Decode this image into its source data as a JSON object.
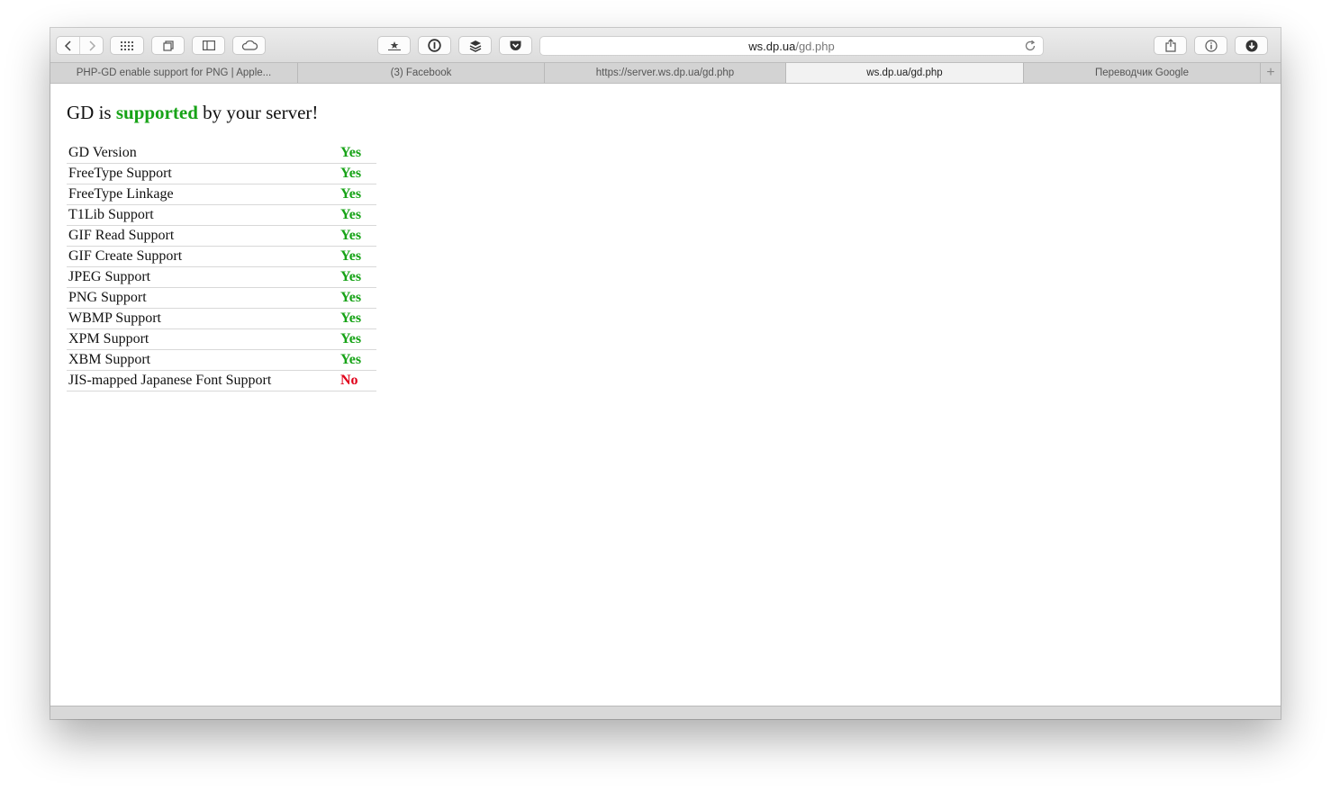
{
  "toolbar": {
    "url_host": "ws.dp.ua",
    "url_path": "/gd.php",
    "icons": [
      "back-icon",
      "forward-icon",
      "top-sites-icon",
      "tabs-overview-icon",
      "sidebar-icon",
      "icloud-icon",
      "bookmark-star-icon",
      "password-icon",
      "buffer-icon",
      "pocket-icon",
      "reload-icon",
      "share-icon",
      "info-icon",
      "download-icon"
    ]
  },
  "tabs": [
    {
      "label": "PHP-GD enable support for PNG | Apple..."
    },
    {
      "label": "(3) Facebook"
    },
    {
      "label": "https://server.ws.dp.ua/gd.php"
    },
    {
      "label": "ws.dp.ua/gd.php"
    },
    {
      "label": "Переводчик Google"
    }
  ],
  "page": {
    "heading_pre": "GD is ",
    "heading_highlight": "supported",
    "heading_post": " by your server!",
    "rows": [
      {
        "label": "GD Version",
        "value": "Yes"
      },
      {
        "label": "FreeType Support",
        "value": "Yes"
      },
      {
        "label": "FreeType Linkage",
        "value": "Yes"
      },
      {
        "label": "T1Lib Support",
        "value": "Yes"
      },
      {
        "label": "GIF Read Support",
        "value": "Yes"
      },
      {
        "label": "GIF Create Support",
        "value": "Yes"
      },
      {
        "label": "JPEG Support",
        "value": "Yes"
      },
      {
        "label": "PNG Support",
        "value": "Yes"
      },
      {
        "label": "WBMP Support",
        "value": "Yes"
      },
      {
        "label": "XPM Support",
        "value": "Yes"
      },
      {
        "label": "XBM Support",
        "value": "Yes"
      },
      {
        "label": "JIS-mapped Japanese Font Support",
        "value": "No"
      }
    ]
  },
  "colors": {
    "yes": "#17a317",
    "no": "#e0001a"
  }
}
